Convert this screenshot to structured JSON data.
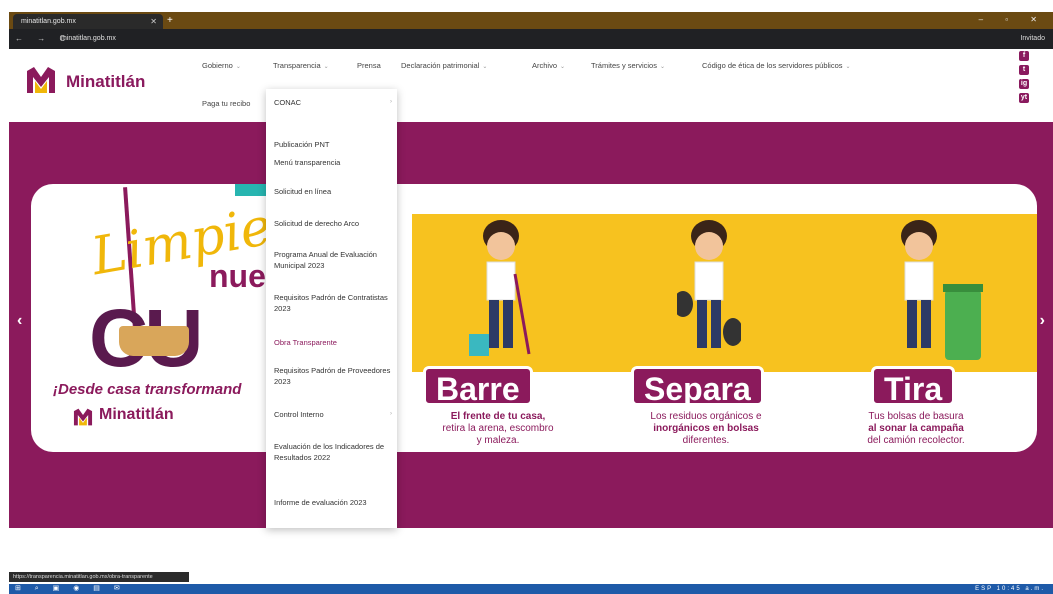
{
  "browser": {
    "tab_title": "minatitlan.gob.mx",
    "new_tab": "+",
    "window_controls": "– ▫ ✕",
    "nav_buttons": "← → C",
    "url": "minatitlan.gob.mx",
    "profile": "Invitado"
  },
  "site": {
    "logo_text": "Minatitlán",
    "menu": [
      "Gobierno",
      "Transparencia",
      "Prensa",
      "Declaración patrimonial",
      "Archivo",
      "Trámites y servicios",
      "Código de ética de los servidores públicos"
    ],
    "menu_row2": "Paga tu recibo",
    "social": [
      "f",
      "t",
      "ig",
      "yt"
    ]
  },
  "dropdown": {
    "items": [
      "CONAC",
      "Publicación PNT",
      "Menú transparencia",
      "Solicitud en línea",
      "Solicitud de derecho Arco",
      "Programa Anual de Evaluación Municipal 2023",
      "Requisitos Padrón de Contratistas 2023",
      "Obra Transparente",
      "Requisitos Padrón de Proveedores 2023",
      "Control Interno",
      "Evaluación de los Indicadores de Resultados 2022",
      "Informe de evaluación 2023"
    ]
  },
  "banner": {
    "slogan_1": "Limpie",
    "slogan_2": "nue",
    "slogan_3": "CU",
    "slogan_line": "¡Desde casa transformand",
    "logo_text": "Minatitlán",
    "actions": [
      {
        "title": "Barre",
        "desc_1": "El frente de tu casa,",
        "desc_2": "retira la arena, escombro",
        "desc_3": "y maleza."
      },
      {
        "title": "Separa",
        "desc_1": "Los residuos orgánicos e",
        "desc_2": "inorgánicos en bolsas",
        "desc_3": "diferentes."
      },
      {
        "title": "Tira",
        "desc_1": "Tus bolsas de basura",
        "desc_2": "al sonar la campaña",
        "desc_3": "del camión recolector."
      }
    ],
    "prev": "‹",
    "next": "›"
  },
  "status_url": "https://transparencia.minatitlan.gob.mx/obra-transparente",
  "taskbar": {
    "icons": "⊞ ⌕ ▣ ◉ ▤ ✉",
    "tray": "ESP 10:45 a.m."
  },
  "colors": {
    "brand": "#8b1a5c",
    "yellow": "#f7c21f",
    "teal": "#27b5b0"
  }
}
